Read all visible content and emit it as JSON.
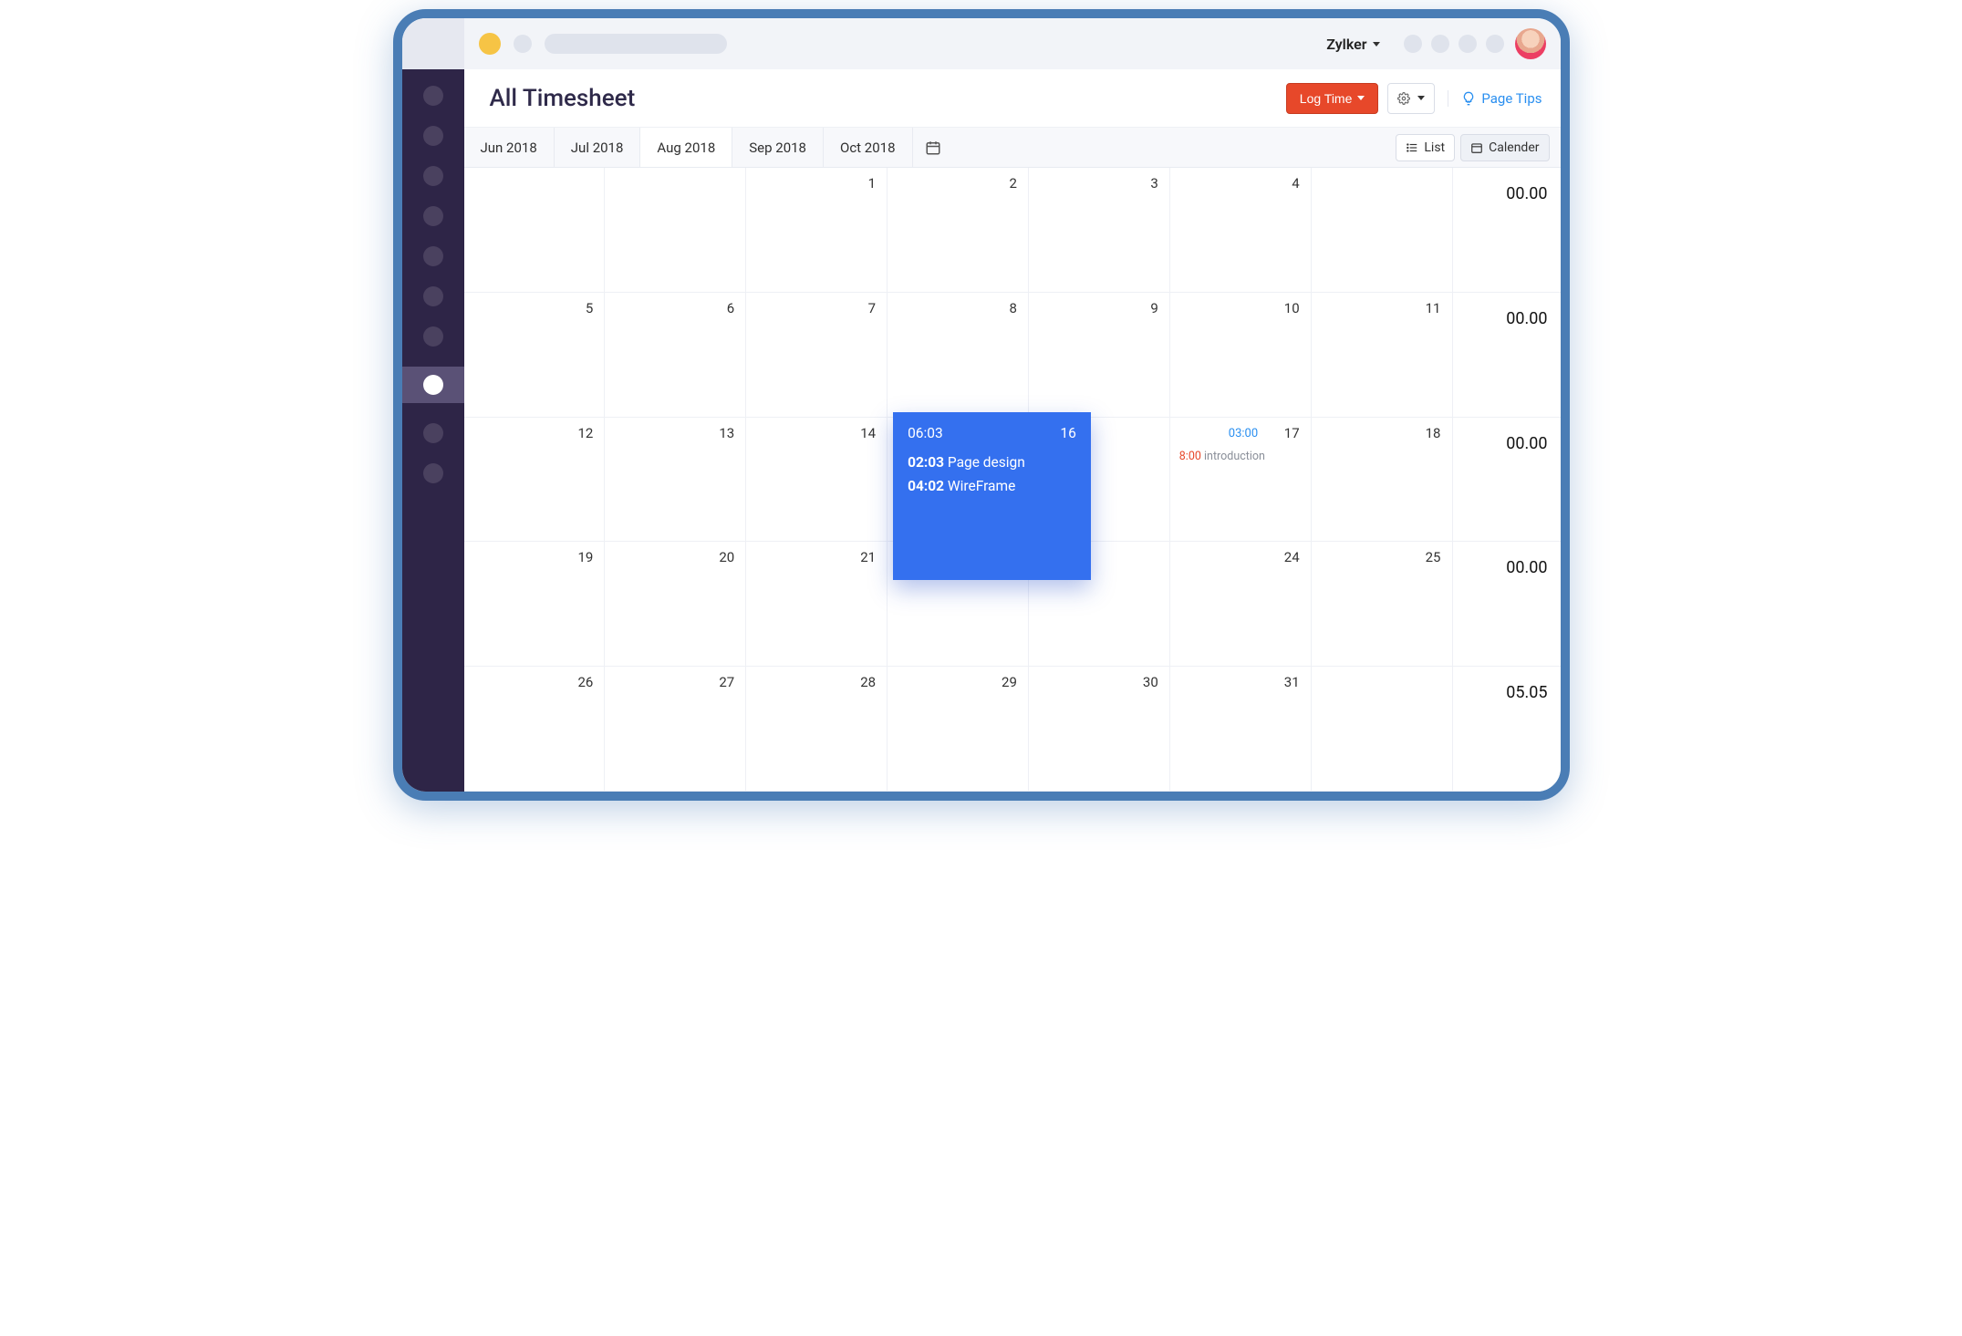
{
  "workspace_name": "Zylker",
  "page_title": "All Timesheet",
  "buttons": {
    "log_time": "Log Time",
    "page_tips": "Page Tips"
  },
  "view_toggle": {
    "list": "List",
    "calendar": "Calender"
  },
  "month_tabs": [
    {
      "label": "Jun 2018",
      "active": false
    },
    {
      "label": "Jul 2018",
      "active": false
    },
    {
      "label": "Aug 2018",
      "active": true
    },
    {
      "label": "Sep 2018",
      "active": false
    },
    {
      "label": "Oct 2018",
      "active": false
    }
  ],
  "calendar": {
    "weeks": [
      {
        "days": [
          "",
          "",
          "1",
          "2",
          "3",
          "4",
          ""
        ],
        "total": "00.00"
      },
      {
        "days": [
          "5",
          "6",
          "7",
          "8",
          "9",
          "10",
          "11"
        ],
        "total": "00.00"
      },
      {
        "days": [
          "12",
          "13",
          "14",
          "",
          "",
          "17",
          "18"
        ],
        "total": "00.00"
      },
      {
        "days": [
          "19",
          "20",
          "21",
          "",
          "",
          "24",
          "25"
        ],
        "total": "00.00"
      },
      {
        "days": [
          "26",
          "27",
          "28",
          "29",
          "30",
          "31",
          ""
        ],
        "total": "05.05"
      }
    ]
  },
  "day17_top_time": "03:00",
  "day17_entry_time": "8:00",
  "day17_entry_label": "introduction",
  "overlay": {
    "time_total": "06:03",
    "daynum": "16",
    "entries": [
      {
        "t": "02:03",
        "label": "Page design"
      },
      {
        "t": "04:02",
        "label": "WireFrame"
      }
    ]
  }
}
